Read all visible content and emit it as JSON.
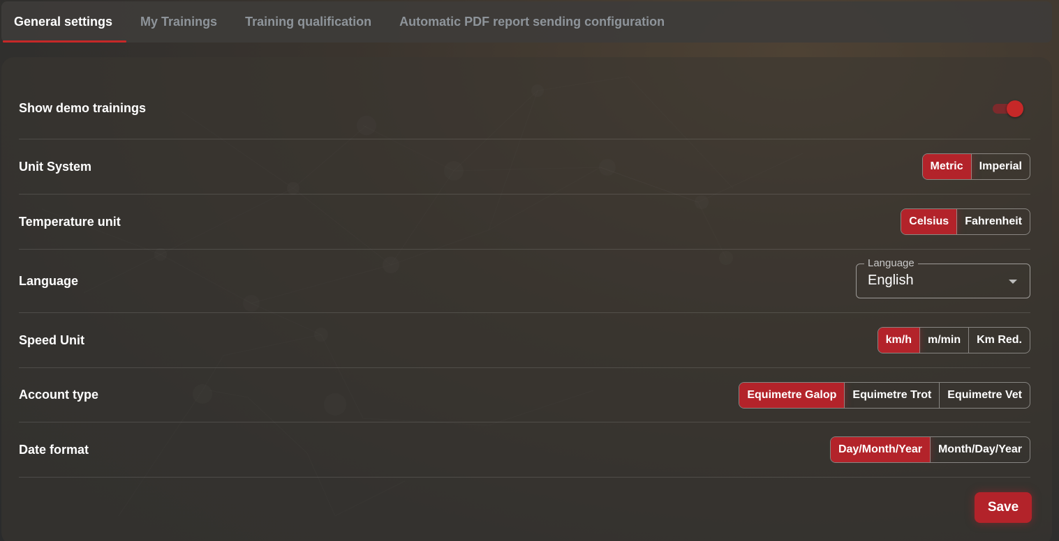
{
  "tabs": [
    {
      "label": "General settings",
      "active": true
    },
    {
      "label": "My Trainings",
      "active": false
    },
    {
      "label": "Training qualification",
      "active": false
    },
    {
      "label": "Automatic PDF report sending configuration",
      "active": false
    }
  ],
  "settings": {
    "demo": {
      "label": "Show demo trainings",
      "enabled": true
    },
    "unit_system": {
      "label": "Unit System",
      "options": [
        "Metric",
        "Imperial"
      ],
      "selected": "Metric"
    },
    "temperature": {
      "label": "Temperature unit",
      "options": [
        "Celsius",
        "Fahrenheit"
      ],
      "selected": "Celsius"
    },
    "language": {
      "label": "Language",
      "field_label": "Language",
      "value": "English"
    },
    "speed": {
      "label": "Speed Unit",
      "options": [
        "km/h",
        "m/min",
        "Km Red."
      ],
      "selected": "km/h"
    },
    "account": {
      "label": "Account type",
      "options": [
        "Equimetre Galop",
        "Equimetre Trot",
        "Equimetre Vet"
      ],
      "selected": "Equimetre Galop"
    },
    "date_format": {
      "label": "Date format",
      "options": [
        "Day/Month/Year",
        "Month/Day/Year"
      ],
      "selected": "Day/Month/Year"
    }
  },
  "save_label": "Save",
  "colors": {
    "accent": "#b3232a",
    "tab_inactive": "#8e949a"
  },
  "icons": {
    "language_dropdown": "chevron-down-icon"
  }
}
